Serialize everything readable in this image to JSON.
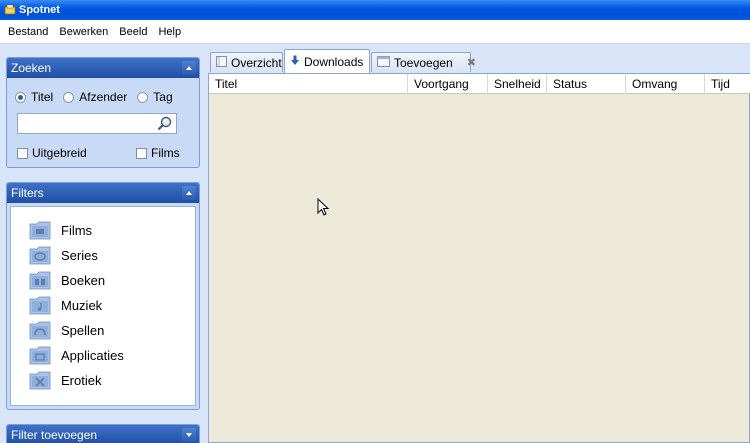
{
  "window": {
    "title": "Spotnet"
  },
  "menu": [
    "Bestand",
    "Bewerken",
    "Beeld",
    "Help"
  ],
  "search_group": {
    "header": "Zoeken",
    "radios": [
      {
        "label": "Titel",
        "checked": true
      },
      {
        "label": "Afzender",
        "checked": false
      },
      {
        "label": "Tag",
        "checked": false
      }
    ],
    "input_value": "",
    "checkboxes": [
      {
        "label": "Uitgebreid",
        "checked": false
      },
      {
        "label": "Films",
        "checked": false
      }
    ]
  },
  "filters_group": {
    "header": "Filters",
    "items": [
      {
        "label": "Films",
        "icon": "film-folder-icon"
      },
      {
        "label": "Series",
        "icon": "tv-folder-icon"
      },
      {
        "label": "Boeken",
        "icon": "book-folder-icon"
      },
      {
        "label": "Muziek",
        "icon": "music-folder-icon"
      },
      {
        "label": "Spellen",
        "icon": "game-folder-icon"
      },
      {
        "label": "Applicaties",
        "icon": "app-folder-icon"
      },
      {
        "label": "Erotiek",
        "icon": "erotic-folder-icon"
      }
    ]
  },
  "add_filter_group": {
    "header": "Filter toevoegen"
  },
  "tabs": [
    {
      "label": "Overzicht",
      "active": false
    },
    {
      "label": "Downloads",
      "active": true
    },
    {
      "label": "Toevoegen",
      "active": false,
      "close": "✖"
    }
  ],
  "downloads_table": {
    "columns": [
      "Titel",
      "Voortgang",
      "Snelheid",
      "Status",
      "Omvang",
      "Tijd"
    ],
    "rows": []
  },
  "colors": {
    "accent": "#1f4fa3",
    "panel_bg": "#d8e4f8",
    "content_bg": "#ece9d8"
  }
}
